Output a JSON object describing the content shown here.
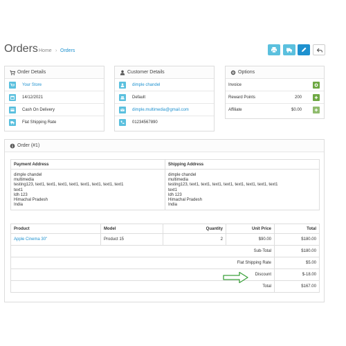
{
  "page": {
    "title": "Orders",
    "breadcrumb": [
      "Home",
      "Orders"
    ],
    "breadcrumb_separator": "›"
  },
  "header_buttons": [
    {
      "icon": "print-icon",
      "style": "info"
    },
    {
      "icon": "truck-icon",
      "style": "info"
    },
    {
      "icon": "pencil-icon",
      "style": "primary"
    },
    {
      "icon": "reply-icon",
      "style": "default"
    }
  ],
  "order_details": {
    "title": "Order Details",
    "store": "Your Store",
    "date": "14/12/2021",
    "payment_method": "Cash On Delivery",
    "shipping_method": "Flat Shipping Rate"
  },
  "customer_details": {
    "title": "Customer Details",
    "name": "dimple chandel",
    "group": "Default",
    "email": "dimple.multimedia@gmail.com",
    "telephone": "01234567890"
  },
  "options": {
    "title": "Options",
    "rows": [
      {
        "label": "Invoice",
        "value": ""
      },
      {
        "label": "Reward Points",
        "value": "200"
      },
      {
        "label": "Affiliate",
        "value": "$0.00"
      }
    ]
  },
  "order": {
    "title": "Order (#1)",
    "payment_address_header": "Payment Address",
    "shipping_address_header": "Shipping Address",
    "payment_address": [
      "dimple chandel",
      "multimedia",
      "testing123, text1, text1, text1, text1, text1, text1, text1, text1",
      "text1",
      "ldh 123",
      "Himachal Pradesh",
      "India"
    ],
    "shipping_address": [
      "dimple chandel",
      "multimedia",
      "testing123, text1, text1, text1, text1, text1, text1, text1, text1",
      "text1",
      "ldh 123",
      "Himachal Pradesh",
      "India"
    ],
    "columns": [
      "Product",
      "Model",
      "Quantity",
      "Unit Price",
      "Total"
    ],
    "products": [
      {
        "name": "Apple Cinema 30\"",
        "model": "Product 15",
        "quantity": "2",
        "unit_price": "$90.00",
        "total": "$180.00"
      }
    ],
    "totals": [
      {
        "label": "Sub-Total",
        "value": "$180.00"
      },
      {
        "label": "Flat Shipping Rate",
        "value": "$5.00"
      },
      {
        "label": "Discount",
        "value": "$-18.00"
      },
      {
        "label": "Total",
        "value": "$167.00"
      }
    ]
  },
  "colors": {
    "accent": "#1e91cf",
    "info": "#5bc0de",
    "success": "#8fbb6c",
    "arrow": "#3aa03a"
  }
}
